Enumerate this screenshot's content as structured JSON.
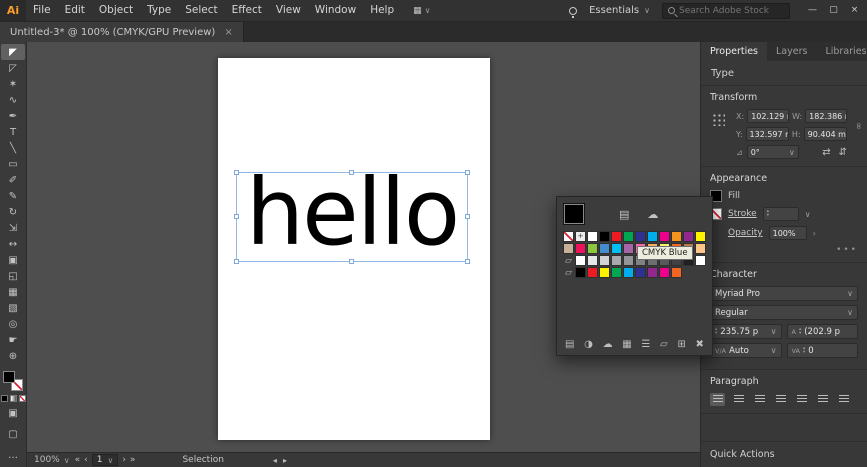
{
  "colors": {
    "selection_outline": "#93b8e8",
    "canvas_background": "#4e4e4e",
    "artboard": "#ffffff",
    "text_fill": "#000000"
  },
  "app": {
    "logo": "Ai",
    "menus": [
      "File",
      "Edit",
      "Object",
      "Type",
      "Select",
      "Effect",
      "View",
      "Window",
      "Help"
    ],
    "arrange_documents_glyph": "▦",
    "chevron": "∨",
    "workspace": "Essentials",
    "search_placeholder": "Search Adobe Stock",
    "window": {
      "minimize": "—",
      "restore": "▢",
      "close": "×"
    }
  },
  "document_tab": {
    "title": "Untitled-3* @ 100% (CMYK/GPU Preview)",
    "close": "×"
  },
  "toolbar": {
    "tools": [
      {
        "name": "selection-tool",
        "glyph": "◤",
        "selected": true
      },
      {
        "name": "direct-selection-tool",
        "glyph": "◸"
      },
      {
        "name": "magic-wand-tool",
        "glyph": "✶"
      },
      {
        "name": "lasso-tool",
        "glyph": "∿"
      },
      {
        "name": "pen-tool",
        "glyph": "✒"
      },
      {
        "name": "type-tool",
        "glyph": "T"
      },
      {
        "name": "line-segment-tool",
        "glyph": "╲"
      },
      {
        "name": "rectangle-tool",
        "glyph": "▭"
      },
      {
        "name": "paintbrush-tool",
        "glyph": "✐"
      },
      {
        "name": "pencil-tool",
        "glyph": "✎"
      },
      {
        "name": "rotate-tool",
        "glyph": "↻"
      },
      {
        "name": "scale-tool",
        "glyph": "⇲"
      },
      {
        "name": "width-tool",
        "glyph": "↔"
      },
      {
        "name": "free-transform-tool",
        "glyph": "▣"
      },
      {
        "name": "shape-builder-tool",
        "glyph": "◱"
      },
      {
        "name": "mesh-tool",
        "glyph": "▦"
      },
      {
        "name": "gradient-tool",
        "glyph": "▧"
      },
      {
        "name": "eyedropper-tool",
        "glyph": "◎"
      },
      {
        "name": "hand-tool",
        "glyph": "☛"
      },
      {
        "name": "zoom-tool",
        "glyph": "⊕"
      }
    ],
    "extra_icons": {
      "draw_mode": "▣",
      "screen_mode": "▢",
      "edit_toolbar": "…"
    }
  },
  "canvas": {
    "text": "hello"
  },
  "swatches_panel": {
    "current_color": "#000000",
    "header_icons": [
      {
        "name": "swatch-libraries-icon",
        "glyph": "▤"
      },
      {
        "name": "color-themes-icon",
        "glyph": "☁"
      }
    ],
    "rows": [
      [
        "none",
        "registration",
        "#ffffff",
        "#000000",
        "#ed1c24",
        "#00a651",
        "#2e3192",
        "#00aeef",
        "#ec008c",
        "#f7941d",
        "#92278f",
        "#fff200"
      ],
      [
        "#c7b299",
        "#ed145b",
        "#8dc63f",
        "#448ccb",
        "#00bff3",
        "#a864a8",
        "#f06eaa",
        "#fbaf5d",
        "#fff568",
        "#f26522",
        "#b97c50",
        "#fdc689"
      ],
      [
        "folder",
        "#ffffff",
        "#e6e7e8",
        "#d1d3d4",
        "#a7a9ac",
        "#939598",
        "#808285",
        "#6d6e71",
        "#58595b",
        "#414042",
        "#231f20",
        "#ffffff"
      ],
      [
        "folder",
        "#000000",
        "#ed1c24",
        "#fff200",
        "#00a651",
        "#00aeef",
        "#2e3192",
        "#92278f",
        "#ec008c",
        "#f26522"
      ]
    ],
    "tooltip": "CMYK Blue",
    "footer_icons": [
      {
        "name": "swatch-libraries-menu-icon",
        "glyph": "▤"
      },
      {
        "name": "color-themes-icon",
        "glyph": "◑"
      },
      {
        "name": "add-to-library-icon",
        "glyph": "☁"
      },
      {
        "name": "show-swatch-kinds-icon",
        "glyph": "▦"
      },
      {
        "name": "swatch-options-icon",
        "glyph": "☰"
      },
      {
        "name": "new-color-group-icon",
        "glyph": "▱"
      },
      {
        "name": "new-swatch-icon",
        "glyph": "⊞"
      },
      {
        "name": "delete-swatch-icon",
        "glyph": "✖"
      }
    ]
  },
  "right_panel": {
    "tabs": [
      "Properties",
      "Layers",
      "Libraries"
    ],
    "active_tab": "Properties",
    "selection_type": "Type",
    "transform": {
      "title": "Transform",
      "x_label": "X:",
      "x": "102.129 m",
      "y_label": "Y:",
      "y": "132.597 m",
      "w_label": "W:",
      "w": "182.386 m",
      "h_label": "H:",
      "h": "90.404 mm",
      "rotate": "0°"
    },
    "appearance": {
      "title": "Appearance",
      "fill_label": "Fill",
      "stroke_label": "Stroke",
      "opacity_label": "Opacity",
      "opacity": "100%",
      "more": "•••"
    },
    "character": {
      "title": "Character",
      "font_family": "Myriad Pro",
      "font_style": "Regular",
      "size": "235.75 p",
      "leading": "(202.9 p",
      "kerning": "Auto",
      "tracking": "0"
    },
    "paragraph": {
      "title": "Paragraph",
      "buttons": [
        "align-left",
        "align-center",
        "align-right",
        "justify-left",
        "justify-center",
        "justify-right",
        "justify-all"
      ]
    },
    "quick_actions_title": "Quick Actions"
  },
  "status_bar": {
    "zoom": "100%",
    "artboard": "1",
    "status": "Selection"
  }
}
